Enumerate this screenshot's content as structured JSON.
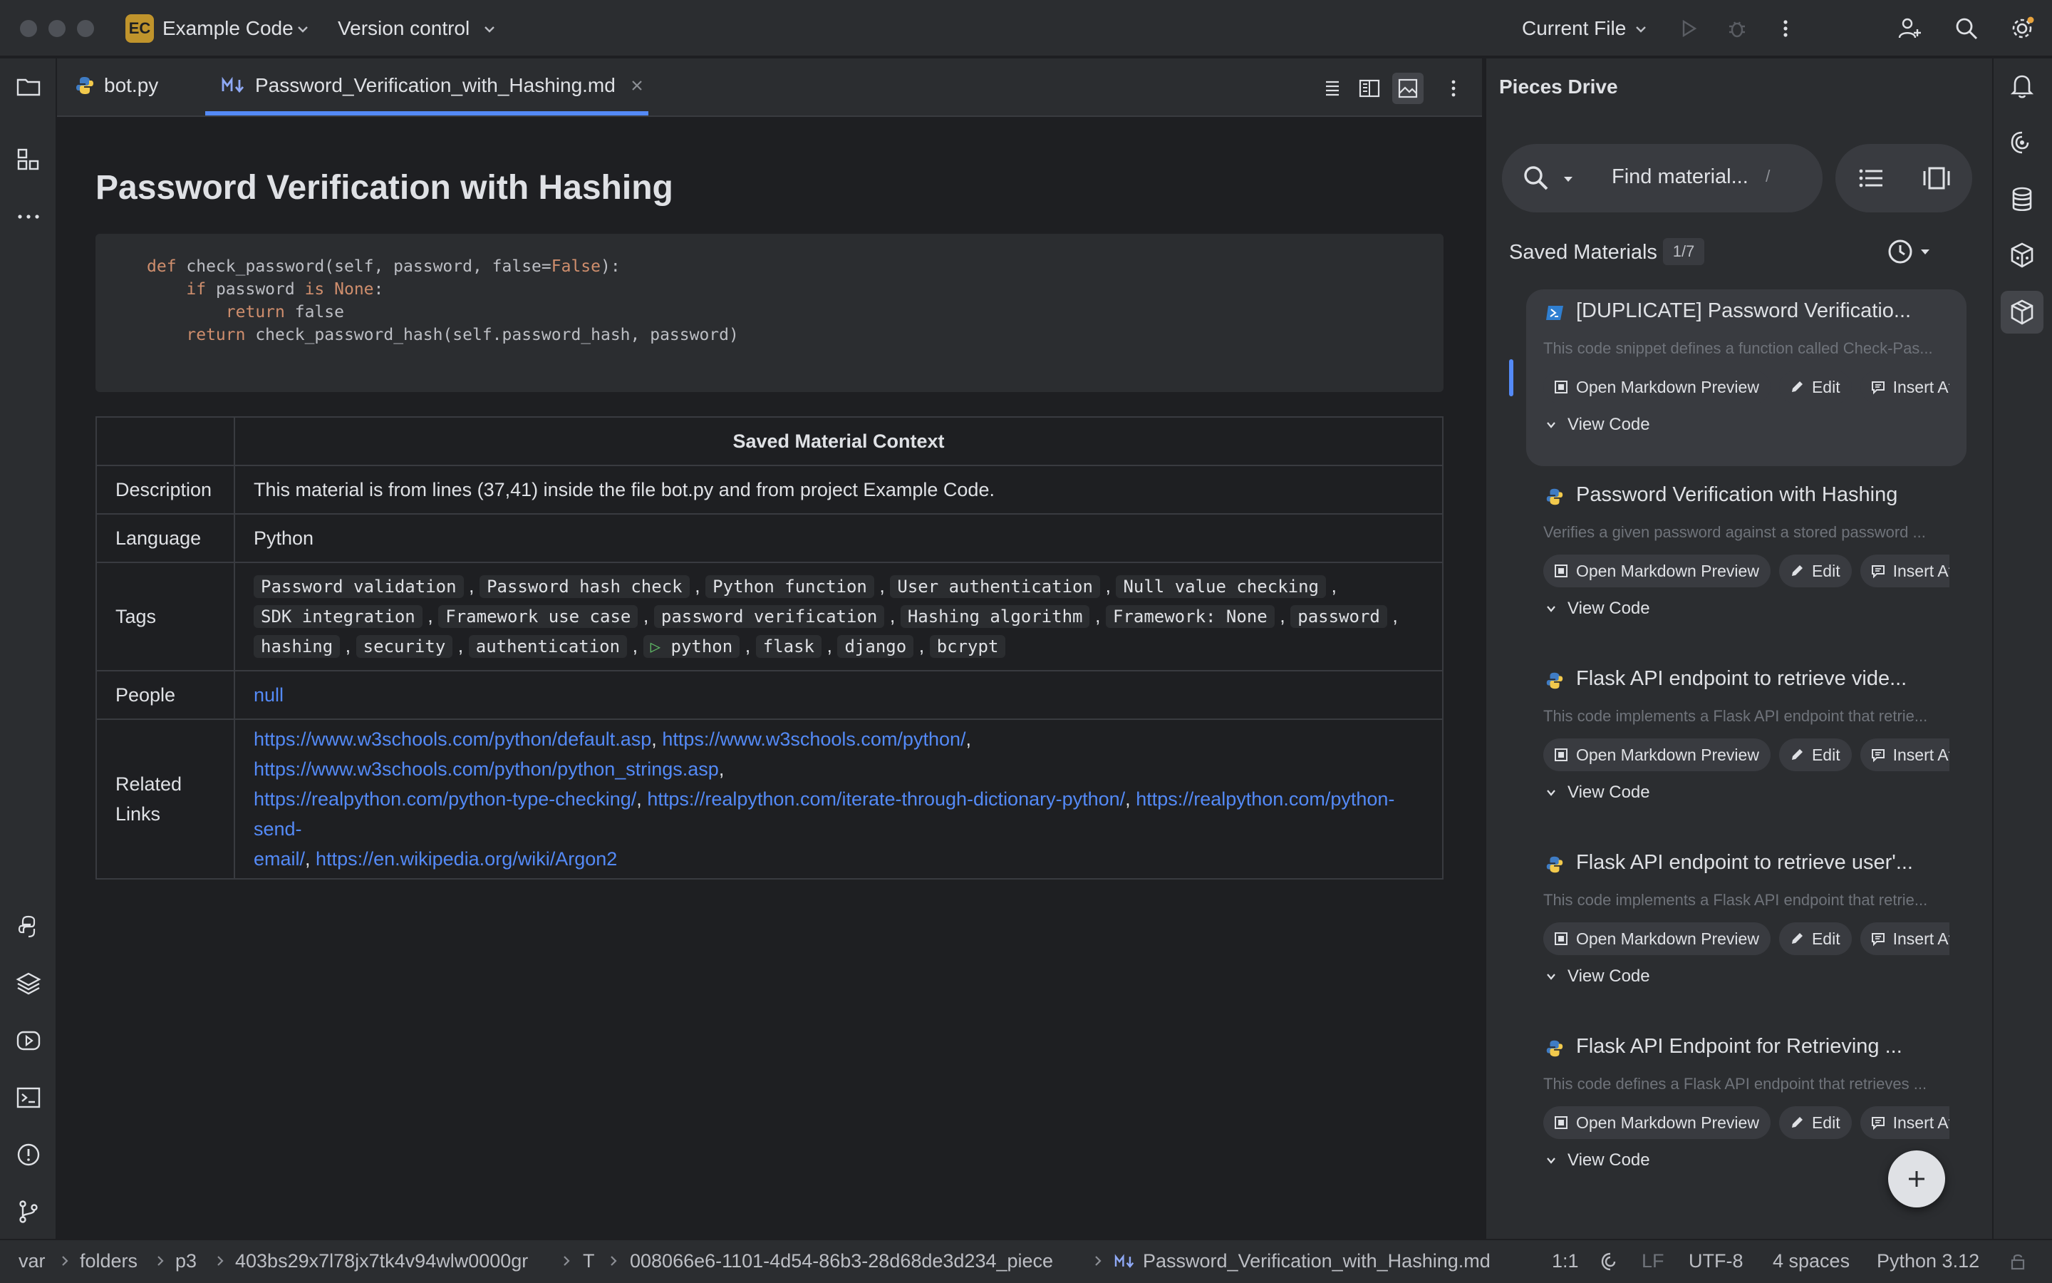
{
  "titlebar": {
    "project_badge": "EC",
    "project_name": "Example Code",
    "vcs": "Version control",
    "run_config": "Current File"
  },
  "tabs": [
    {
      "label": "bot.py",
      "icon": "python-icon"
    },
    {
      "label": "Password_Verification_with_Hashing.md",
      "icon": "markdown-icon",
      "active": true
    }
  ],
  "doc": {
    "title": "Password Verification with Hashing",
    "code": {
      "l1_kw": "def",
      "l1_rest": " check_password(self, password, false=",
      "l1_false": "False",
      "l1_end": "):",
      "l2_kw": "if",
      "l2_mid": " password ",
      "l2_is": "is",
      "l2_none": " None",
      "l2_end": ":",
      "l3_kw": "return",
      "l3_rest": " false",
      "l4_kw": "return",
      "l4_rest": " check_password_hash(self.password_hash, password)"
    },
    "table": {
      "header": "Saved Material Context",
      "description_label": "Description",
      "description": "This material is from lines (37,41) inside the file bot.py and from project Example Code.",
      "language_label": "Language",
      "language": "Python",
      "tags_label": "Tags",
      "tags": [
        "Password validation",
        "Password hash check",
        "Python function",
        "User authentication",
        "Null value checking",
        "SDK integration",
        "Framework use case",
        "password verification",
        "Hashing algorithm",
        "Framework: None",
        "password",
        "hashing",
        "security",
        "authentication",
        "python",
        "flask",
        "django",
        "bcrypt"
      ],
      "people_label": "People",
      "people": "null",
      "links_label_1": "Related",
      "links_label_2": "Links",
      "links": [
        "https://www.w3schools.com/python/default.asp",
        "https://www.w3schools.com/python/",
        "https://www.w3schools.com/python/python_strings.asp",
        "https://realpython.com/python-type-checking/",
        "https://realpython.com/iterate-through-dictionary-python/",
        "https://realpython.com/python-send-",
        "email/",
        "https://en.wikipedia.org/wiki/Argon2"
      ]
    }
  },
  "pieces": {
    "title": "Pieces Drive",
    "search_placeholder": "Find material...",
    "search_shortcut": "/",
    "saved_label": "Saved Materials",
    "saved_count": "1/7",
    "btn_preview": "Open Markdown Preview",
    "btn_edit": "Edit",
    "btn_insert": "Insert At",
    "view_code": "View Code",
    "cards": [
      {
        "title": "[DUPLICATE] Password Verificatio...",
        "desc": "This code snippet defines a function called Check-Pas...",
        "icon": "powershell-icon"
      },
      {
        "title": "Password Verification with Hashing",
        "desc": "Verifies a given password against a stored password ...",
        "icon": "python-icon"
      },
      {
        "title": "Flask API endpoint to retrieve vide...",
        "desc": "This code implements a Flask API endpoint that retrie...",
        "icon": "python-icon"
      },
      {
        "title": "Flask API endpoint to retrieve user'...",
        "desc": "This code implements a Flask API endpoint that retrie...",
        "icon": "python-icon"
      },
      {
        "title": "Flask API Endpoint for Retrieving ...",
        "desc": "This code defines a Flask API endpoint that retrieves ...",
        "icon": "python-icon"
      }
    ]
  },
  "statusbar": {
    "crumbs": [
      "var",
      "folders",
      "p3",
      "403bs29x7l78jx7tk4v94wlw0000gr",
      "T",
      "008066e6-1101-4d54-86b3-28d68de3d234_piece",
      "Password_Verification_with_Hashing.md"
    ],
    "position": "1:1",
    "line_sep": "LF",
    "encoding": "UTF-8",
    "indent": "4 spaces",
    "interpreter": "Python 3.12"
  },
  "colors": {
    "accent": "#548af7",
    "bg": "#1e1f22",
    "panel": "#2b2d30",
    "badge": "#c0942c"
  }
}
